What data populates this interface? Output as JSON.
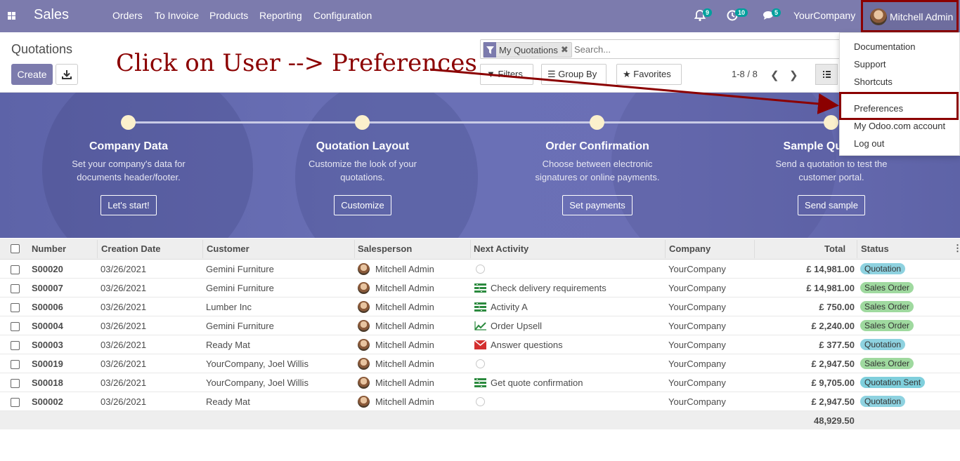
{
  "navbar": {
    "app_name": "Sales",
    "menus": [
      "Orders",
      "To Invoice",
      "Products",
      "Reporting",
      "Configuration"
    ],
    "notifications": {
      "bell_count": "9",
      "activity_count": "10",
      "messages_count": "5"
    },
    "company": "YourCompany",
    "user": "Mitchell Admin"
  },
  "control": {
    "breadcrumb": "Quotations",
    "create_label": "Create",
    "search_facet": "My Quotations",
    "search_placeholder": "Search...",
    "filters_label": "Filters",
    "groupby_label": "Group By",
    "favorites_label": "Favorites",
    "pager": "1-8 / 8"
  },
  "annotation": "Click on User --> Preferences",
  "onboarding": {
    "steps": [
      {
        "title": "Company Data",
        "desc": "Set your company's data for documents header/footer.",
        "button": "Let's start!"
      },
      {
        "title": "Quotation Layout",
        "desc": "Customize the look of your quotations.",
        "button": "Customize"
      },
      {
        "title": "Order Confirmation",
        "desc": "Choose between electronic signatures or online payments.",
        "button": "Set payments"
      },
      {
        "title": "Sample Quotation",
        "desc": "Send a quotation to test the customer portal.",
        "button": "Send sample"
      }
    ]
  },
  "table": {
    "columns": [
      "Number",
      "Creation Date",
      "Customer",
      "Salesperson",
      "Next Activity",
      "Company",
      "Total",
      "Status"
    ],
    "rows": [
      {
        "number": "S00020",
        "date": "03/26/2021",
        "customer": "Gemini Furniture",
        "salesperson": "Mitchell Admin",
        "activity": "",
        "activity_icon": "clock-icon",
        "company": "YourCompany",
        "total": "£ 14,981.00",
        "status": "Quotation"
      },
      {
        "number": "S00007",
        "date": "03/26/2021",
        "customer": "Gemini Furniture",
        "salesperson": "Mitchell Admin",
        "activity": "Check delivery requirements",
        "activity_icon": "tasks-icon",
        "company": "YourCompany",
        "total": "£ 14,981.00",
        "status": "Sales Order"
      },
      {
        "number": "S00006",
        "date": "03/26/2021",
        "customer": "Lumber Inc",
        "salesperson": "Mitchell Admin",
        "activity": "Activity A",
        "activity_icon": "tasks-icon",
        "company": "YourCompany",
        "total": "£ 750.00",
        "status": "Sales Order"
      },
      {
        "number": "S00004",
        "date": "03/26/2021",
        "customer": "Gemini Furniture",
        "salesperson": "Mitchell Admin",
        "activity": "Order Upsell",
        "activity_icon": "line-chart-icon",
        "company": "YourCompany",
        "total": "£ 2,240.00",
        "status": "Sales Order"
      },
      {
        "number": "S00003",
        "date": "03/26/2021",
        "customer": "Ready Mat",
        "salesperson": "Mitchell Admin",
        "activity": "Answer questions",
        "activity_icon": "envelope-icon",
        "company": "YourCompany",
        "total": "£ 377.50",
        "status": "Quotation"
      },
      {
        "number": "S00019",
        "date": "03/26/2021",
        "customer": "YourCompany, Joel Willis",
        "salesperson": "Mitchell Admin",
        "activity": "",
        "activity_icon": "clock-icon",
        "company": "YourCompany",
        "total": "£ 2,947.50",
        "status": "Sales Order"
      },
      {
        "number": "S00018",
        "date": "03/26/2021",
        "customer": "YourCompany, Joel Willis",
        "salesperson": "Mitchell Admin",
        "activity": "Get quote confirmation",
        "activity_icon": "tasks-icon",
        "company": "YourCompany",
        "total": "£ 9,705.00",
        "status": "Quotation Sent"
      },
      {
        "number": "S00002",
        "date": "03/26/2021",
        "customer": "Ready Mat",
        "salesperson": "Mitchell Admin",
        "activity": "",
        "activity_icon": "clock-icon",
        "company": "YourCompany",
        "total": "£ 2,947.50",
        "status": "Quotation"
      }
    ],
    "footer_total": "48,929.50"
  },
  "user_menu": {
    "items": [
      "Documentation",
      "Support",
      "Shortcuts",
      "Preferences",
      "My Odoo.com account",
      "Log out"
    ]
  },
  "colors": {
    "brand": "#7c7bad",
    "annotation": "#8b0000",
    "status_quotation": "#8ed2e0",
    "status_sales_order": "#9fd99f",
    "status_quotation_sent": "#7fcfdc"
  }
}
